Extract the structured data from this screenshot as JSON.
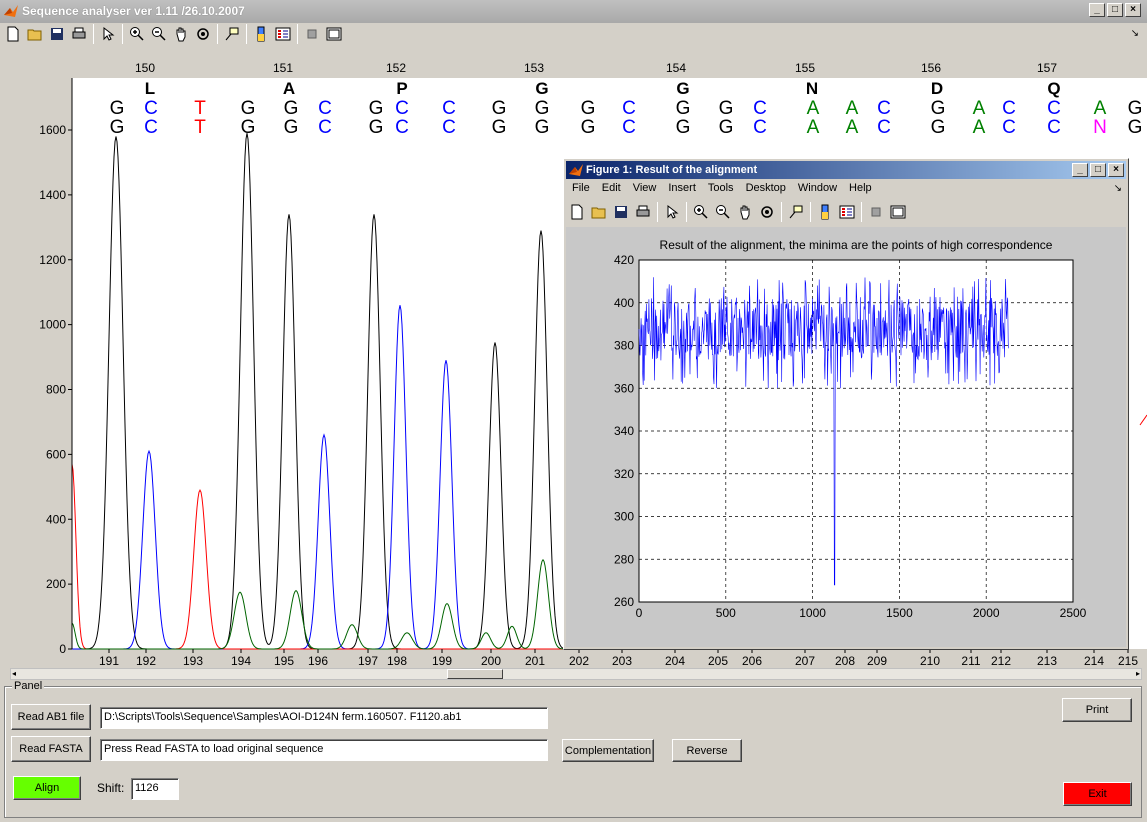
{
  "window": {
    "title": "Sequence analyser ver 1.11 /26.10.2007"
  },
  "toolbar_icons": [
    "new-file-icon",
    "open-folder-icon",
    "save-icon",
    "print-icon",
    "pointer-icon",
    "zoom-in-icon",
    "zoom-out-icon",
    "pan-hand-icon",
    "rotate-3d-icon",
    "data-cursor-icon",
    "colorbar-icon",
    "legend-icon",
    "hide-plot-tools-icon",
    "show-plot-tools-icon"
  ],
  "chromatogram": {
    "y_ticks": [
      "1600",
      "1400",
      "1200",
      "1000",
      "800",
      "600",
      "400",
      "200",
      "0"
    ],
    "codon_numbers": [
      "150",
      "151",
      "152",
      "153",
      "154",
      "155",
      "156",
      "157"
    ],
    "amino_acids": [
      "L",
      "A",
      "P",
      "G",
      "G",
      "N",
      "D",
      "Q"
    ],
    "seq_row1": [
      "G",
      "C",
      "T",
      "G",
      "G",
      "C",
      "G",
      "C",
      "C",
      "G",
      "G",
      "G",
      "C",
      "G",
      "G",
      "C",
      "A",
      "A",
      "C",
      "G",
      "A",
      "C",
      "C",
      "A",
      "G"
    ],
    "seq_row2": [
      "G",
      "C",
      "T",
      "G",
      "G",
      "C",
      "G",
      "C",
      "C",
      "G",
      "G",
      "G",
      "C",
      "G",
      "G",
      "C",
      "A",
      "A",
      "C",
      "G",
      "A",
      "C",
      "C",
      "N",
      "G"
    ],
    "x_ticks": [
      "191",
      "192",
      "193",
      "194",
      "195",
      "196",
      "197",
      "198",
      "199",
      "200",
      "201",
      "202",
      "203",
      "204",
      "205",
      "206",
      "207",
      "208",
      "209",
      "210",
      "211",
      "212",
      "213",
      "214",
      "215"
    ],
    "colors": {
      "G": "#000000",
      "C": "#0000ff",
      "T": "#ff0000",
      "A": "#008000",
      "N": "#ff00ff"
    }
  },
  "figure": {
    "title": "Figure 1: Result of the alignment",
    "menu": [
      "File",
      "Edit",
      "View",
      "Insert",
      "Tools",
      "Desktop",
      "Window",
      "Help"
    ],
    "plot_title": "Result of the alignment, the minima are the points of high correspondence"
  },
  "chart_data": {
    "type": "line",
    "title": "Result of the alignment, the minima are the points of high correspondence",
    "xlabel": "",
    "ylabel": "",
    "xlim": [
      0,
      2500
    ],
    "ylim": [
      260,
      420
    ],
    "x_ticks": [
      0,
      500,
      1000,
      1500,
      2000,
      2500
    ],
    "y_ticks": [
      260,
      280,
      300,
      320,
      340,
      360,
      380,
      400,
      420
    ],
    "grid": true,
    "series": [
      {
        "color": "#0000ff",
        "x_range": [
          0,
          2130
        ],
        "baseline": 388,
        "noise_range": [
          360,
          412
        ],
        "minimum": {
          "x": 1126,
          "y": 268
        }
      }
    ]
  },
  "panel": {
    "label": "Panel",
    "read_ab1_label": "Read AB1 file",
    "ab1_path": "D:\\Scripts\\Tools\\Sequence\\Samples\\AOI-D124N ferm.160507.  F1120.ab1",
    "read_fasta_label": "Read FASTA",
    "fasta_message": "Press Read FASTA to load original sequence",
    "complementation_label": "Complementation",
    "reverse_label": "Reverse",
    "print_label": "Print",
    "align_label": "Align",
    "shift_label": "Shift:",
    "shift_value": "1126",
    "exit_label": "Exit",
    "align_color": "#66ff00",
    "exit_color": "#ff0000"
  }
}
